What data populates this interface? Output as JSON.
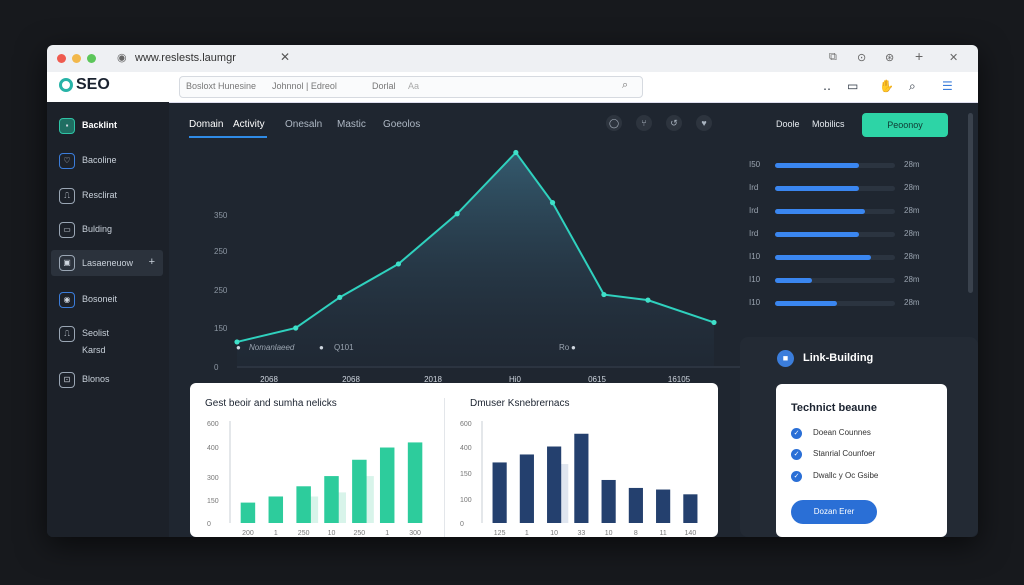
{
  "browser": {
    "tab_title": "www.reslests.laumgr",
    "close": "✕",
    "window_controls": [
      "⧉",
      "⊙",
      "⊛",
      "+",
      "✕"
    ]
  },
  "toolbar": {
    "logo_text": "SEO",
    "search_left": "Bosloxt Hunesine",
    "search_mid": "Johnnol | Edreol",
    "search_right": "Dorlal",
    "search_placeholder_tail": "Aa",
    "icons": [
      "search-icon"
    ],
    "right_icons": [
      "‥",
      "▭",
      "✋",
      "🔍",
      "☰"
    ]
  },
  "sidebar": {
    "items": [
      {
        "label": "Backlint",
        "icon": "☐"
      },
      {
        "label": "Bacoline",
        "icon": "♡"
      },
      {
        "label": "Resclirat",
        "icon": "⎍"
      },
      {
        "label": "Bulding",
        "icon": "▭"
      },
      {
        "label": "Lasaeneuow",
        "icon": "▣",
        "extra": "+"
      },
      {
        "label": "Bosoneit",
        "icon": "◉"
      },
      {
        "label": "Seolist",
        "icon": "⎍",
        "sub": "Karsd"
      },
      {
        "label": "Blonos",
        "icon": "⊡"
      }
    ]
  },
  "nav": {
    "tabs": [
      "Domain",
      "Activity",
      "Onesaln",
      "Mastic",
      "Goeolos"
    ],
    "icons": [
      "◯",
      "⑂",
      "↺",
      "♥"
    ],
    "labels": [
      "Doole",
      "Mobilics"
    ],
    "cta_label": "Peoonoy"
  },
  "main_chart": {
    "legend": [
      "Nomanlaeed",
      "Q101",
      "Ro"
    ]
  },
  "chart_data": [
    {
      "type": "area",
      "x": [
        "2068",
        "2068",
        "2018",
        "Hi0",
        "0615",
        "16105"
      ],
      "y_ticks": [
        "0",
        "150",
        "250",
        "250",
        "350"
      ],
      "points_x": [
        0,
        0.8,
        1.4,
        2.2,
        3.0,
        3.8,
        4.3,
        5.0,
        5.6,
        6.5
      ],
      "values": [
        45,
        70,
        125,
        185,
        275,
        385,
        295,
        130,
        120,
        80
      ],
      "ylim": [
        0,
        350
      ],
      "title": "",
      "xlabel": "",
      "ylabel": ""
    },
    {
      "type": "bar",
      "title": "Gest beoir and sumha nelicks",
      "categories": [
        "200",
        "1",
        "250",
        "10",
        "250",
        "1",
        "300"
      ],
      "values": [
        100,
        130,
        180,
        230,
        310,
        370,
        395
      ],
      "ghost_values": [
        0,
        0,
        130,
        150,
        230,
        0,
        0
      ],
      "y_ticks": [
        "0",
        "150",
        "300",
        "400",
        "600"
      ],
      "ylim": [
        0,
        500
      ]
    },
    {
      "type": "bar",
      "title": "Dmuser Ksnebrernacs",
      "categories": [
        "125",
        "1",
        "10",
        "33",
        "10",
        "8",
        "11",
        "140"
      ],
      "values": [
        190,
        215,
        240,
        280,
        135,
        110,
        105,
        90
      ],
      "ghost_values": [
        0,
        0,
        185,
        0,
        0,
        0,
        0,
        0
      ],
      "y_ticks": [
        "0",
        "100",
        "150",
        "400",
        "600"
      ],
      "ylim": [
        0,
        320
      ]
    },
    {
      "type": "bar",
      "orientation": "horizontal",
      "rows": [
        {
          "label": "I50",
          "value": 0.7,
          "right": "28m"
        },
        {
          "label": "Ird",
          "value": 0.7,
          "right": "28m"
        },
        {
          "label": "Ird",
          "value": 0.75,
          "right": "28m"
        },
        {
          "label": "Ird",
          "value": 0.7,
          "right": "28m"
        },
        {
          "label": "I10",
          "value": 0.8,
          "right": "28m"
        },
        {
          "label": "I10",
          "value": 0.31,
          "right": "28m"
        },
        {
          "label": "I10",
          "value": 0.52,
          "right": "28m"
        }
      ]
    }
  ],
  "link_building": {
    "title": "Link-Building",
    "card_title": "Technict beaune",
    "checks": [
      "Doean Counnes",
      "Stanrial Counfoer",
      "Dwallc y Oc Gsibe"
    ],
    "button": "Dozan Erer"
  },
  "colors": {
    "accent_teal": "#2dd4a6",
    "accent_blue": "#3a86f0",
    "bg_dark": "#1f2630"
  }
}
